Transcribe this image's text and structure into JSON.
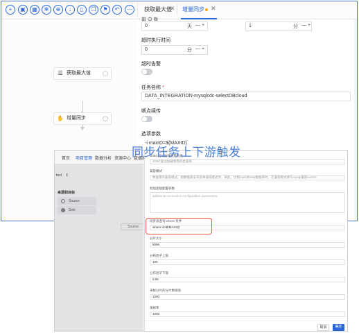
{
  "window_top": {
    "toolbar": {
      "icons": [
        "add-icon",
        "save-icon",
        "grid-icon",
        "settings-icon",
        "zoom-in-icon",
        "download-icon",
        "delete-icon",
        "copy-icon",
        "format-icon",
        "undo-icon",
        "more-icon"
      ]
    },
    "tabs": [
      {
        "label": "获取最大值",
        "close": "✕"
      },
      {
        "label": "增量同步",
        "close": "✕"
      }
    ],
    "dag": {
      "nodes": [
        {
          "label": "获取最大值",
          "icon": "database-icon"
        },
        {
          "label": "增量同步",
          "icon": "sync-icon"
        }
      ]
    },
    "form": {
      "row_top": {
        "value1": "0",
        "unit1": "天",
        "value2": "1",
        "unit2": "分"
      },
      "timeout_label": "超时执行时间",
      "timeout_value": "0",
      "timeout_unit": "分",
      "timeout_alarm_label": "超时告警",
      "task_name_label": "任务名称",
      "task_name_required": "*",
      "task_name_value": "DATA_INTEGRATION-mysqlcdc-selectDBcloud",
      "resume_label": "断点续传",
      "options_label": "选项参数",
      "options_value": "-i maxID=${MAXID}",
      "stepper_minus": "—",
      "stepper_plus": "+"
    }
  },
  "window_bottom": {
    "nav": [
      "首页",
      "项目管理",
      "数据分析",
      "资源中心",
      "数据质量"
    ],
    "nav_active_index": 1,
    "side": {
      "test_label": "test",
      "test_value": "0",
      "section_title": "来源和目标",
      "items": [
        "Source",
        "Sink"
      ]
    },
    "canvas_chip": "Source",
    "dialog": {
      "jdbc_label": "JDBC驱动加载使用的类",
      "jdbc_placeholder": "JDBC驱动加载使用的类名称",
      "mode_label": "兼容模式",
      "mode_placeholder": "数据库的兼容模式。如数据库支持多种兼容模式时，将此，比如mysqlDeep数据库时，在兼容模式填写mysql兼容source",
      "extra_label": "附加连接配置参数",
      "extra_placeholder": "additional connection configuration parameters",
      "where_label": "同步表查询 where 条件",
      "where_value": "where id>${MAXID}",
      "split_size_label": "分片大小",
      "split_size_value": "8096",
      "factor_upper_label": "分布因子上限",
      "factor_upper_value": "100",
      "factor_lower_label": "分布因子下限",
      "factor_lower_value": "0.05",
      "sample_threshold_label": "采样分片的分片数阈值",
      "sample_threshold_value": "1000",
      "sample_rate_label": "采样率",
      "sample_rate_value": "1000",
      "cancel": "取消",
      "confirm": "确定"
    },
    "annotation": "同步任务上下游触发"
  },
  "colors": {
    "accent": "#2b67d6",
    "highlight": "#e85a3a",
    "annotation": "#4a7fd8",
    "tab_dot": "#f5a623"
  }
}
